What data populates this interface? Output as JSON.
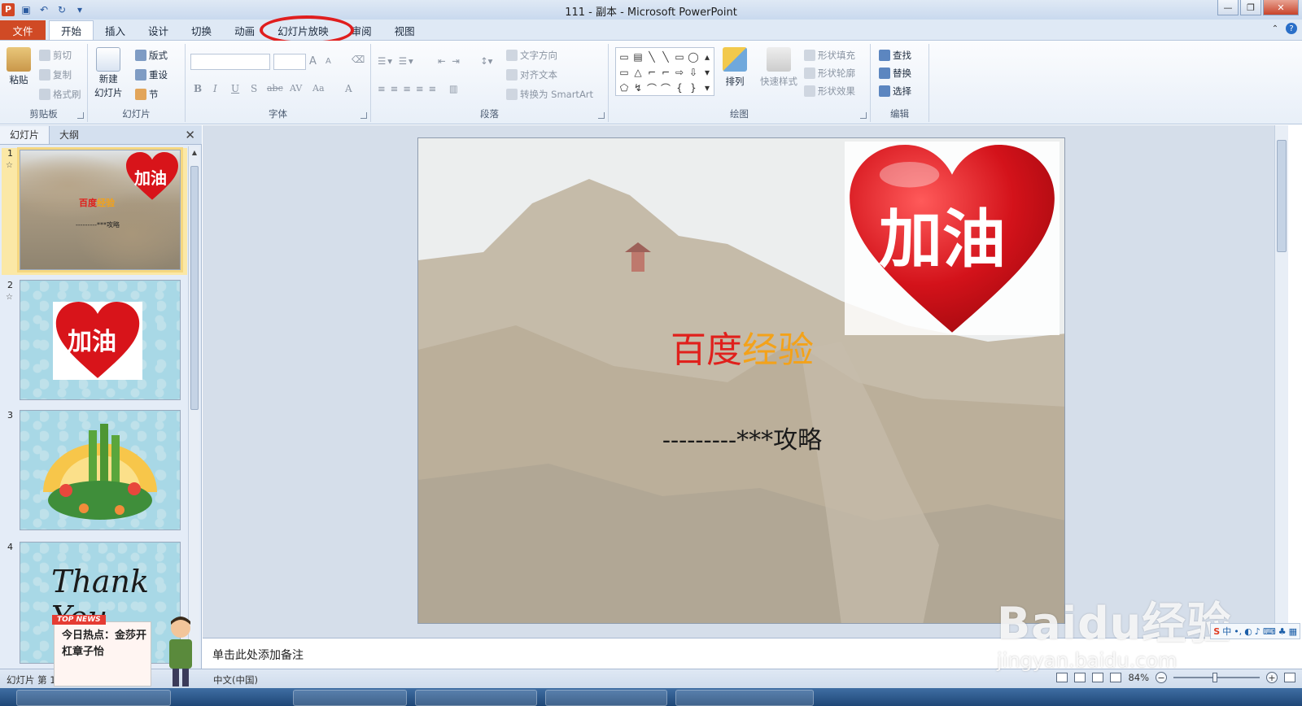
{
  "window": {
    "title": "111 - 副本 - Microsoft PowerPoint",
    "app_icon": "P",
    "qat": [
      "save-icon",
      "undo-icon",
      "redo-icon",
      "customize-icon"
    ]
  },
  "ribbon_tabs": [
    "文件",
    "开始",
    "插入",
    "设计",
    "切换",
    "动画",
    "幻灯片放映",
    "审阅",
    "视图"
  ],
  "active_tab": "开始",
  "highlighted_tab": "幻灯片放映",
  "clipboard": {
    "paste": "粘贴",
    "cut": "剪切",
    "copy": "复制",
    "format_painter": "格式刷",
    "label": "剪贴板"
  },
  "slides_group": {
    "new_slide_1": "新建",
    "new_slide_2": "幻灯片",
    "layout": "版式",
    "reset": "重设",
    "section": "节",
    "label": "幻灯片"
  },
  "font_group": {
    "label": "字体",
    "grow": "A",
    "shrink": "A",
    "bold": "B",
    "italic": "I",
    "underline": "U",
    "shadow": "S",
    "strike": "abc",
    "spacing": "AV",
    "case": "Aa",
    "color": "A"
  },
  "paragraph_group": {
    "label": "段落",
    "text_direction": "文字方向",
    "align_text": "对齐文本",
    "smartart": "转换为 SmartArt"
  },
  "drawing_group": {
    "label": "绘图",
    "arrange": "排列",
    "quick_styles": "快速样式",
    "shape_fill": "形状填充",
    "shape_outline": "形状轮廓",
    "shape_effects": "形状效果"
  },
  "editing_group": {
    "label": "编辑",
    "find": "查找",
    "replace": "替换",
    "select": "选择"
  },
  "panel": {
    "tab_slides": "幻灯片",
    "tab_outline": "大纲",
    "close": "✕"
  },
  "thumbnails": [
    {
      "num": "1",
      "title_red": "百度",
      "title_orange": "经验",
      "sub": "---------***攻略",
      "heart": "加油"
    },
    {
      "num": "2",
      "heart": "加油"
    },
    {
      "num": "3"
    },
    {
      "num": "4",
      "text": "Thank You"
    }
  ],
  "slide": {
    "heart_text": "加油",
    "title_red": "百度",
    "title_orange": "经验",
    "subtitle": "---------***攻略"
  },
  "notes_placeholder": "单击此处添加备注",
  "status": {
    "slide_info": "幻灯片 第 1",
    "language": "中文(中国)",
    "zoom": "84%"
  },
  "news": {
    "tag": "TOP NEWS",
    "text": "今日热点：金莎开杠章子怡"
  },
  "watermark": {
    "main": "Baidu经验",
    "sub": "jingyan.baidu.com"
  },
  "colors": {
    "accent": "#d04a25",
    "highlight_circle": "#e01e1e",
    "title_red": "#e0201c",
    "title_orange": "#f3a21a"
  }
}
